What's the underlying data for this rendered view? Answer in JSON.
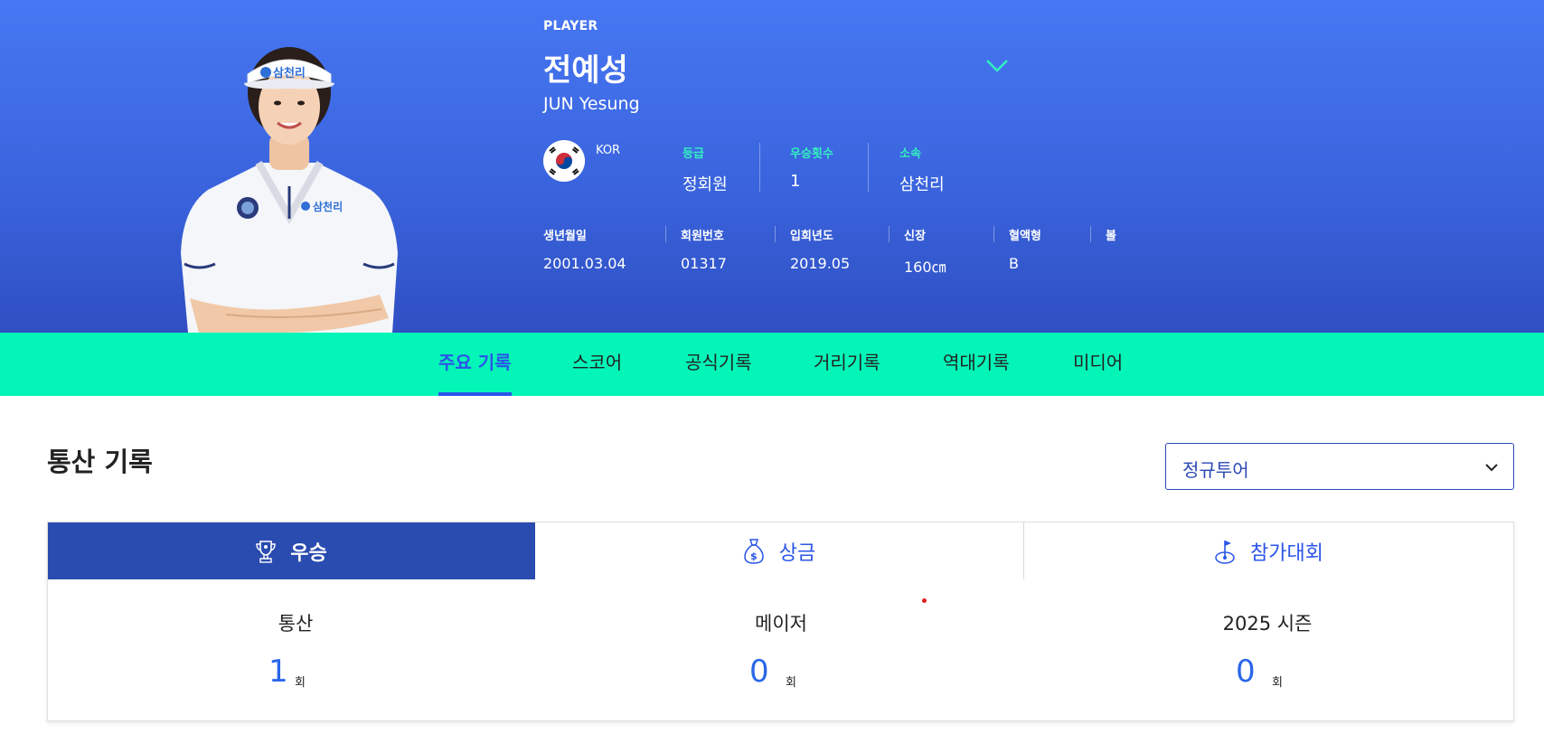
{
  "hero": {
    "tag": "PLAYER",
    "name": "전예성",
    "name_en": "JUN Yesung",
    "nation": "KOR",
    "stats": [
      {
        "label": "등급",
        "value": "정회원"
      },
      {
        "label": "우승횟수",
        "value": "1"
      },
      {
        "label": "소속",
        "value": "삼천리"
      }
    ],
    "info": [
      {
        "label": "생년월일",
        "value": "2001.03.04"
      },
      {
        "label": "회원번호",
        "value": "01317"
      },
      {
        "label": "입회년도",
        "value": "2019.05"
      },
      {
        "label": "신장",
        "value": "160㎝"
      },
      {
        "label": "혈액형",
        "value": "B"
      },
      {
        "label": "볼",
        "value": ""
      }
    ],
    "cap_logo_text": "삼천리",
    "shirt_logo_text": "삼천리"
  },
  "tabs": [
    "주요 기록",
    "스코어",
    "공식기록",
    "거리기록",
    "역대기록",
    "미디어"
  ],
  "active_tab": "주요 기록",
  "section": {
    "title": "통산 기록",
    "select_value": "정규투어",
    "subtabs": [
      {
        "label": "우승",
        "icon": "trophy-icon"
      },
      {
        "label": "상금",
        "icon": "money-bag-icon"
      },
      {
        "label": "참가대회",
        "icon": "golf-flag-icon"
      }
    ],
    "records": [
      {
        "label": "통산",
        "value": "1",
        "unit": "회"
      },
      {
        "label": "메이저",
        "value": "0",
        "unit": "회"
      },
      {
        "label": "2025 시즌",
        "value": "0",
        "unit": "회"
      }
    ]
  },
  "colors": {
    "hero_top": "#4777f3",
    "hero_bottom": "#2f4fc2",
    "tab_bar": "#04f5b8",
    "accent": "#2a55e8",
    "stat_label": "#33f0bf",
    "subtab_active": "#2a4bb0"
  }
}
